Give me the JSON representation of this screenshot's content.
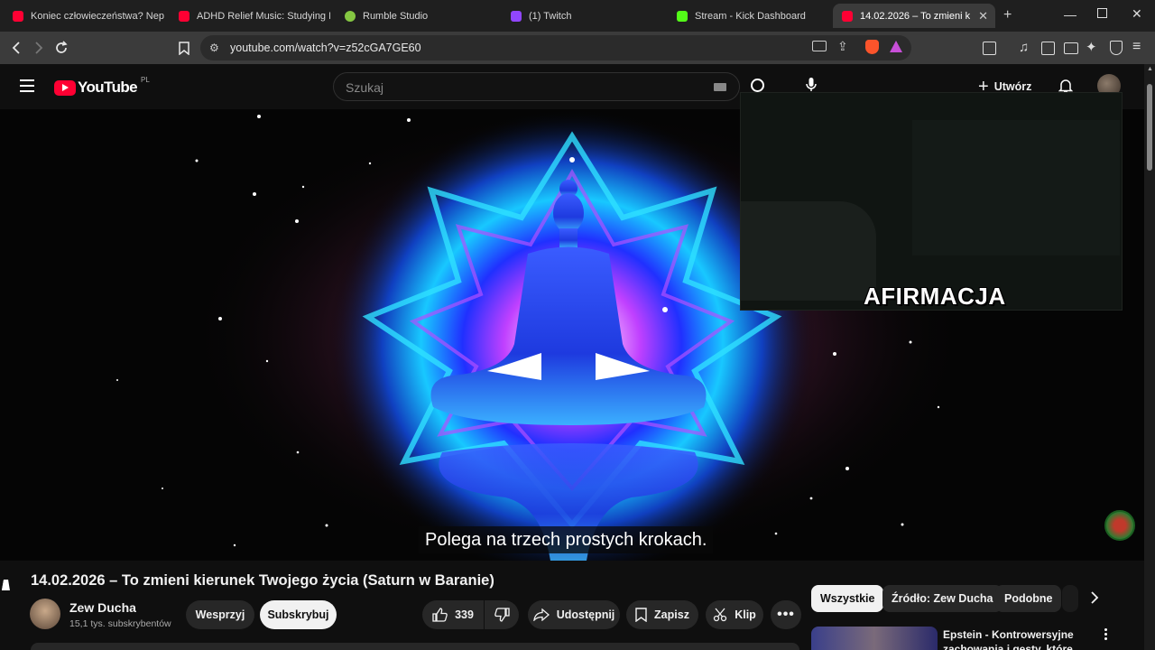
{
  "browser": {
    "tabs": [
      {
        "title": "Koniec człowieczeństwa? Nepals",
        "favicon": "youtube-icon",
        "color": "#ff0033"
      },
      {
        "title": "ADHD Relief Music: Studying Mu",
        "favicon": "youtube-icon",
        "color": "#ff0033"
      },
      {
        "title": "Rumble Studio",
        "favicon": "rumble-icon",
        "color": "#85c742"
      },
      {
        "title": "(1) Twitch",
        "favicon": "twitch-icon",
        "color": "#9146ff"
      },
      {
        "title": "Stream - Kick Dashboard",
        "favicon": "kick-icon",
        "color": "#53fc18"
      },
      {
        "title": "14.02.2026 – To zmieni kieru",
        "favicon": "youtube-icon",
        "color": "#ff0033",
        "active": true
      }
    ],
    "url": "youtube.com/watch?v=z52cGA7GE60"
  },
  "youtube": {
    "logo_text": "YouTube",
    "region": "PL",
    "search_placeholder": "Szukaj",
    "create_label": "Utwórz"
  },
  "video": {
    "overlay_text": "AFIRMACJA",
    "caption": "Polega na trzech prostych krokach.",
    "title": "14.02.2026 – To zmieni kierunek Twojego życia (Saturn w Baranie)"
  },
  "channel": {
    "name": "Zew Ducha",
    "subscribers": "15,1 tys. subskrybentów",
    "support_label": "Wesprzyj",
    "subscribe_label": "Subskrybuj"
  },
  "actions": {
    "likes": "339",
    "share_label": "Udostępnij",
    "save_label": "Zapisz",
    "clip_label": "Klip"
  },
  "chips": [
    "Wszystkie",
    "Źródło: Zew Ducha",
    "Podobne"
  ],
  "recommended": {
    "title": "Epstein - Kontrowersyjne zachowania i gesty, które"
  },
  "colors": {
    "accent": "#ff0033",
    "background": "#0f0f0f"
  }
}
